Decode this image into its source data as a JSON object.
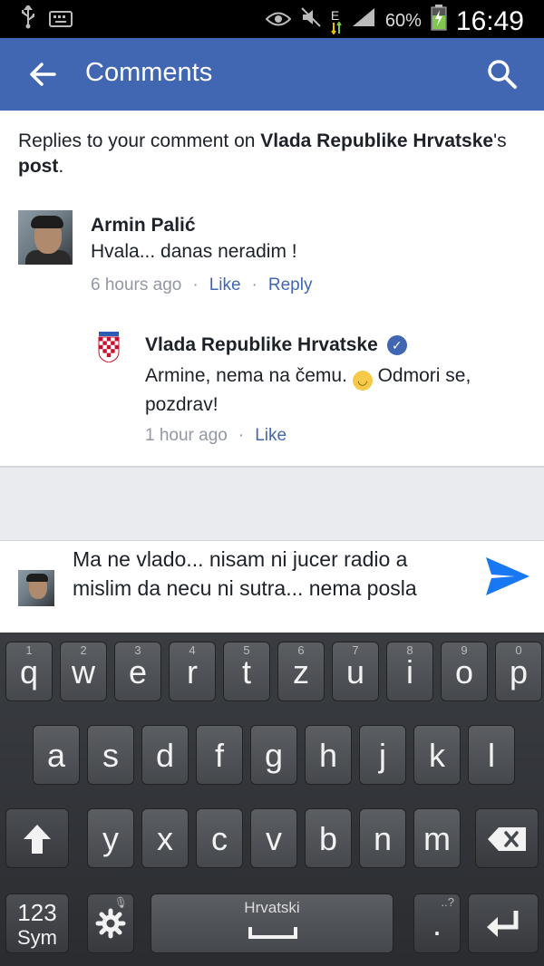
{
  "status_bar": {
    "battery": "60%",
    "time": "16:49",
    "network": "E"
  },
  "app_bar": {
    "title": "Comments"
  },
  "intro": {
    "prefix": "Replies to your comment on ",
    "page_name": "Vlada Republike Hrvatske",
    "suffix_1": "'s ",
    "post_word": "post",
    "suffix_2": "."
  },
  "comment": {
    "author": "Armin Palić",
    "text": "Hvala... danas neradim !",
    "time": "6 hours ago",
    "like": "Like",
    "reply": "Reply"
  },
  "reply": {
    "author": "Vlada Republike Hrvatske",
    "text_before_emoji": "Armine, nema na čemu. ",
    "text_after_emoji": " Odmori se, pozdrav!",
    "time": "1 hour ago",
    "like": "Like"
  },
  "composer": {
    "value": "Ma ne vlado... nisam ni jucer radio a mislim da necu ni sutra... nema posla"
  },
  "keyboard": {
    "row1": [
      {
        "key": "q",
        "hint": "1"
      },
      {
        "key": "w",
        "hint": "2"
      },
      {
        "key": "e",
        "hint": "3"
      },
      {
        "key": "r",
        "hint": "4"
      },
      {
        "key": "t",
        "hint": "5"
      },
      {
        "key": "z",
        "hint": "6"
      },
      {
        "key": "u",
        "hint": "7"
      },
      {
        "key": "i",
        "hint": "8"
      },
      {
        "key": "o",
        "hint": "9"
      },
      {
        "key": "p",
        "hint": "0"
      }
    ],
    "row2": [
      "a",
      "s",
      "d",
      "f",
      "g",
      "h",
      "j",
      "k",
      "l"
    ],
    "row3": [
      "y",
      "x",
      "c",
      "v",
      "b",
      "n",
      "m"
    ],
    "sym_label_top": "123",
    "sym_label_bottom": "Sym",
    "space_label": "Hrvatski",
    "period": ".",
    "period_hint": "..?"
  },
  "colors": {
    "brand": "#4267b2",
    "send": "#1877f2"
  }
}
